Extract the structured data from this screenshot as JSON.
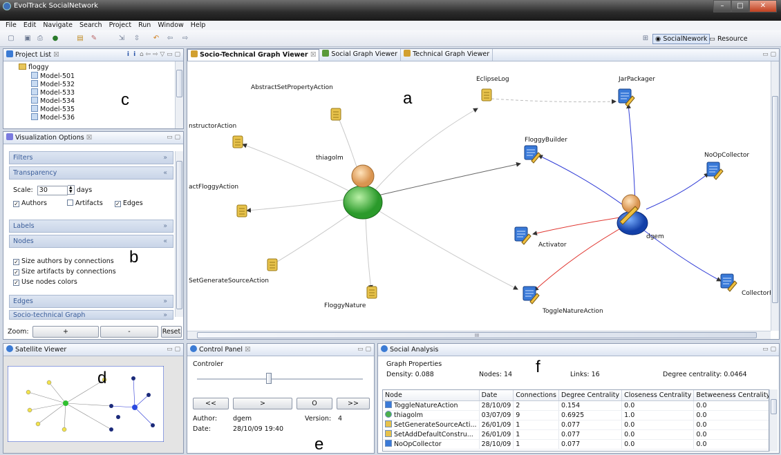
{
  "window": {
    "title": "EvolTrack SocialNetwork",
    "btn_min": "–",
    "btn_max": "□",
    "btn_close": "✕"
  },
  "menu": [
    "File",
    "Edit",
    "Navigate",
    "Search",
    "Project",
    "Run",
    "Window",
    "Help"
  ],
  "perspectives": [
    "SocialNework",
    "Resource"
  ],
  "annotations": {
    "a": "a",
    "b": "b",
    "c": "c",
    "d": "d",
    "e": "e",
    "f": "f"
  },
  "project_list": {
    "title": "Project List",
    "root": "floggy",
    "items": [
      "Model-501",
      "Model-532",
      "Model-533",
      "Model-534",
      "Model-535",
      "Model-536"
    ]
  },
  "vis_options": {
    "title": "Visualization Options",
    "filters": "Filters",
    "transparency": "Transparency",
    "scale_label": "Scale:",
    "scale_value": "30",
    "days": "days",
    "authors": "Authors",
    "artifacts": "Artifacts",
    "edges_cb": "Edges",
    "labels": "Labels",
    "nodes": "Nodes",
    "size_authors": "Size authors by connections",
    "size_artifacts": "Size artifacts by connections",
    "use_colors": "Use nodes colors",
    "edges": "Edges",
    "socio": "Socio-technical Graph",
    "zoom": "Zoom:",
    "zoom_in": "+",
    "zoom_out": "-",
    "reset": "Reset"
  },
  "graph_tabs": [
    "Socio-Technical Graph Viewer",
    "Social Graph Viewer",
    "Technical Graph Viewer"
  ],
  "graph": {
    "labels": {
      "abstract_set": "AbstractSetPropertyAction",
      "ctor": "nstructorAction",
      "floggy_action": "actFloggyAction",
      "setgen": "SetGenerateSourceAction",
      "nature": "FloggyNature",
      "thiagolm": "thiagolm",
      "eclipselog": "EclipseLog",
      "jarpackager": "JarPackager",
      "builder": "FloggyBuilder",
      "noop": "NoOpCollector",
      "activator": "Activator",
      "dgem": "dgem",
      "toggle": "ToggleNatureAction",
      "collector": "CollectorFa"
    },
    "hscroll_mid": "III"
  },
  "satellite": {
    "title": "Satellite Viewer"
  },
  "control": {
    "title": "Control Panel",
    "group": "Controler",
    "first": "<<",
    "next": ">",
    "o": "O",
    "last": ">>",
    "author_label": "Author:",
    "author": "dgem",
    "version_label": "Version:",
    "version": "4",
    "date_label": "Date:",
    "date": "28/10/09 19:40"
  },
  "social": {
    "title": "Social Analysis",
    "group": "Graph Properties",
    "density": "Density: 0.088",
    "nodes": "Nodes: 14",
    "links": "Links: 16",
    "degree": "Degree centrality: 0.0464",
    "columns": [
      "Node",
      "Date",
      "Connections",
      "Degree Centrality",
      "Closeness Centrality",
      "Betweeness Centrality"
    ],
    "rows": [
      [
        "ToggleNatureAction",
        "28/10/09",
        "2",
        "0.154",
        "0.0",
        "0.0"
      ],
      [
        "thiagolm",
        "03/07/09",
        "9",
        "0.6925",
        "1.0",
        "0.0"
      ],
      [
        "SetGenerateSourceActi...",
        "26/01/09",
        "1",
        "0.077",
        "0.0",
        "0.0"
      ],
      [
        "SetAddDefaultConstru...",
        "26/01/09",
        "1",
        "0.077",
        "0.0",
        "0.0"
      ],
      [
        "NoOpCollector",
        "28/10/09",
        "1",
        "0.077",
        "0.0",
        "0.0"
      ]
    ]
  },
  "colors": {
    "social_edge": "#c9c9c9",
    "dgem_edge_blue": "#2f3bd6",
    "dgem_edge_red": "#e0352f",
    "accent": "#3a5d9a"
  }
}
